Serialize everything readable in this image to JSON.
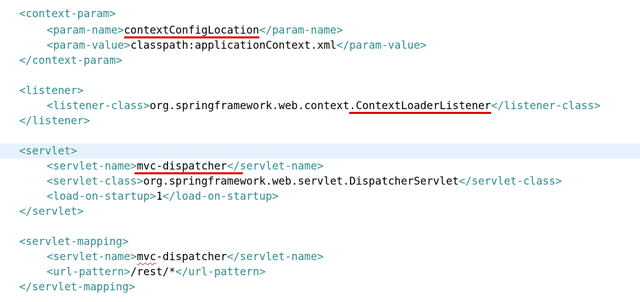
{
  "editor": {
    "lines": {
      "l1": {
        "open": "<context-param>"
      },
      "l2": {
        "open": "<param-name>",
        "value": "contextConfigLocation",
        "close": "</param-name>"
      },
      "l3": {
        "open": "<param-value>",
        "value": "classpath:applicationContext.xml",
        "close": "</param-value>"
      },
      "l4": {
        "close": "</context-param>"
      },
      "l6": {
        "open": "<listener>"
      },
      "l7": {
        "open": "<listener-class>",
        "value_prefix": "org.springframework.web.context",
        "value_marked": ".ContextLoaderListener",
        "close": "</listener-class>"
      },
      "l8": {
        "close": "</listener>"
      },
      "l10": {
        "open_bracket": "<",
        "open_rest": "servlet>"
      },
      "l11": {
        "open": "<servlet-name>",
        "value": "mvc-dispatcher",
        "close": "</servlet-name>"
      },
      "l12": {
        "open": "<servlet-class>",
        "value": "org.springframework.web.servlet.DispatcherServlet",
        "close": "</servlet-class>"
      },
      "l13": {
        "open": "<load-on-startup>",
        "value": "1",
        "close": "</load-on-startup>"
      },
      "l14": {
        "close": "</servlet>"
      },
      "l16": {
        "open": "<servlet-mapping>"
      },
      "l17": {
        "open": "<servlet-name>",
        "value_squiggle": "mvc",
        "value_rest": "-dispatcher",
        "close": "</servlet-name>"
      },
      "l18": {
        "open": "<url-pattern>",
        "value": "/rest/*",
        "close": "</url-pattern>"
      },
      "l19": {
        "close": "</servlet-mapping>"
      }
    },
    "colors": {
      "tag": "#2e8b8b",
      "text": "#000000",
      "annotation_underline": "#e00000",
      "current_line": "#e8f2fe"
    }
  }
}
